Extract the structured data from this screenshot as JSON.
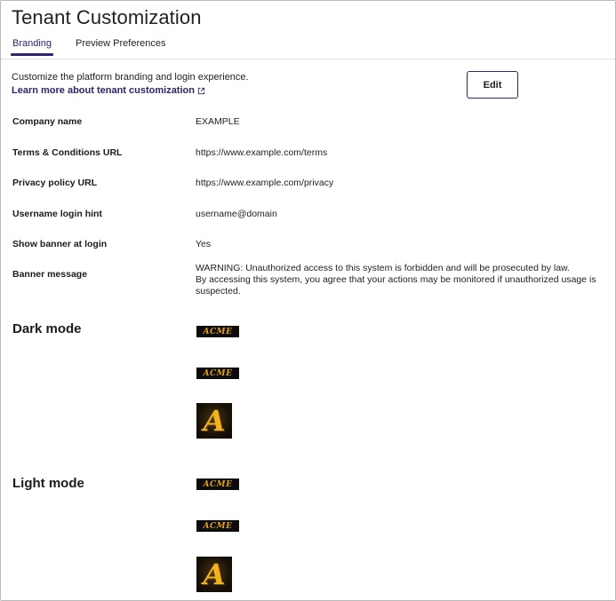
{
  "page": {
    "title": "Tenant Customization"
  },
  "tabs": [
    {
      "label": "Branding",
      "active": true
    },
    {
      "label": "Preview Preferences",
      "active": false
    }
  ],
  "intro": {
    "description": "Customize the platform branding and login experience.",
    "learn_more": "Learn more about tenant customization",
    "learn_more_icon": "external-link-icon"
  },
  "toolbar": {
    "edit_label": "Edit"
  },
  "fields": [
    {
      "label": "Company name",
      "value": "EXAMPLE"
    },
    {
      "label": "Terms & Conditions URL",
      "value": "https://www.example.com/terms"
    },
    {
      "label": "Privacy policy URL",
      "value": "https://www.example.com/privacy"
    },
    {
      "label": "Username login hint",
      "value": "username@domain"
    },
    {
      "label": "Show banner at login",
      "value": "Yes"
    },
    {
      "label": "Banner message",
      "value_line1": "WARNING: Unauthorized access to this system is forbidden and will be prosecuted by law.",
      "value_line2": "By accessing this system, you agree that your actions may be monitored if unauthorized usage is suspected."
    }
  ],
  "dark_mode": {
    "heading": "Dark mode",
    "logo_wide_text": "ACME",
    "logo_icon_text": "A"
  },
  "light_mode": {
    "heading": "Light mode",
    "logo_wide_text": "ACME",
    "logo_icon_text": "A"
  },
  "colors": {
    "accent": "#2b2470",
    "logo_gold": "#e0a21c",
    "logo_bg": "#0c0c0c"
  }
}
